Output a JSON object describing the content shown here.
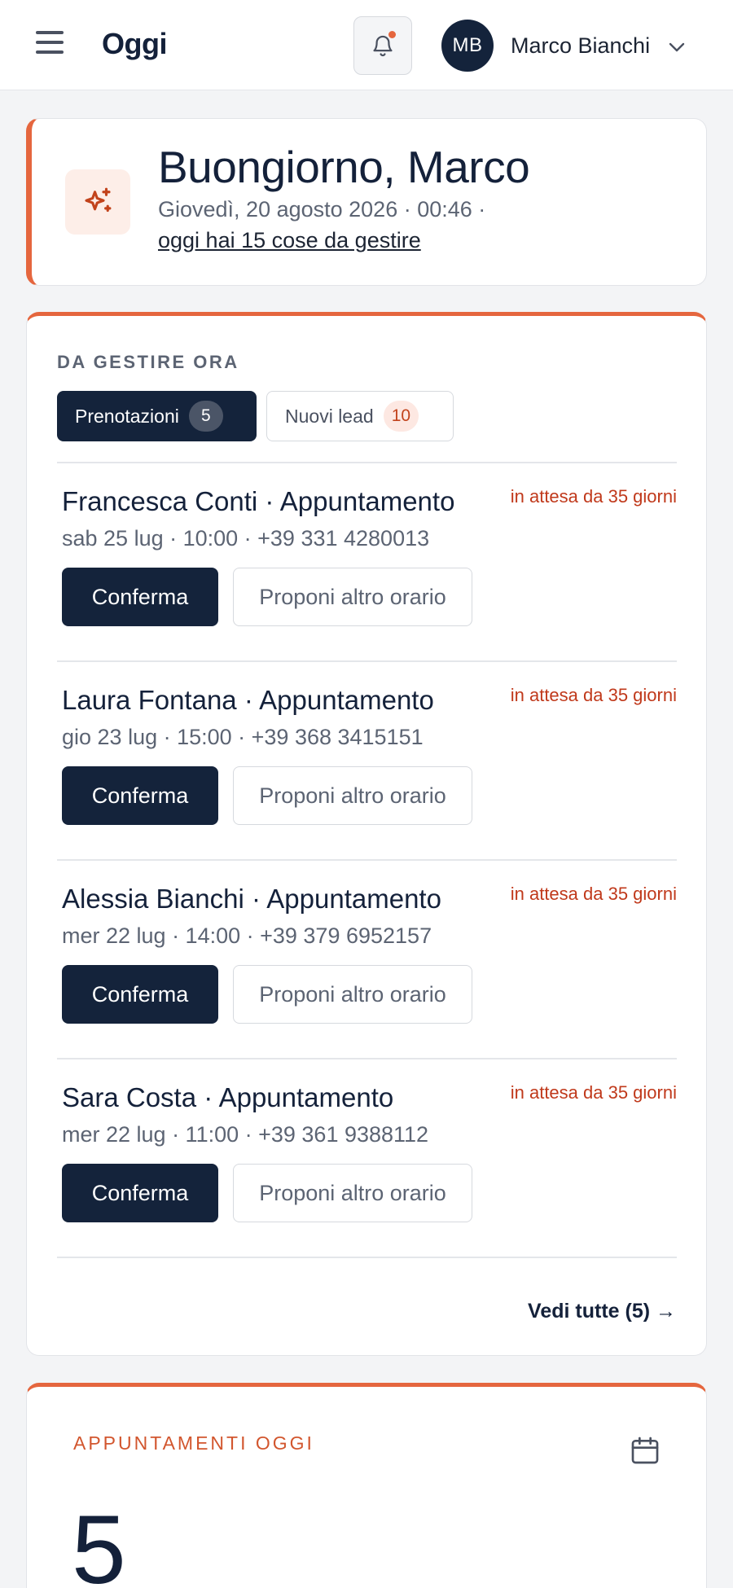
{
  "header": {
    "title": "Oggi",
    "user_initials": "MB",
    "user_name": "Marco Bianchi",
    "notification_dot_color": "#e5663e"
  },
  "greeting": {
    "title": "Buongiorno, Marco",
    "date_line": "Giovedì, 20 agosto 2026 · 00:46 ·",
    "tasks_link": "oggi hai 15 cose da gestire"
  },
  "todo": {
    "section_label": "DA GESTIRE ORA",
    "tabs": [
      {
        "label": "Prenotazioni",
        "count": "5",
        "active": true
      },
      {
        "label": "Nuovi lead",
        "count": "10",
        "active": false
      }
    ],
    "bookings": [
      {
        "title": "Francesca Conti · Appuntamento",
        "meta": "sab 25 lug · 10:00 · +39 331 4280013",
        "waiting": "in attesa da 35 giorni",
        "confirm_label": "Conferma",
        "propose_label": "Proponi altro orario"
      },
      {
        "title": "Laura Fontana · Appuntamento",
        "meta": "gio 23 lug · 15:00 · +39 368 3415151",
        "waiting": "in attesa da 35 giorni",
        "confirm_label": "Conferma",
        "propose_label": "Proponi altro orario"
      },
      {
        "title": "Alessia Bianchi · Appuntamento",
        "meta": "mer 22 lug · 14:00 · +39 379 6952157",
        "waiting": "in attesa da 35 giorni",
        "confirm_label": "Conferma",
        "propose_label": "Proponi altro orario"
      },
      {
        "title": "Sara Costa · Appuntamento",
        "meta": "mer 22 lug · 11:00 · +39 361 9388112",
        "waiting": "in attesa da 35 giorni",
        "confirm_label": "Conferma",
        "propose_label": "Proponi altro orario"
      }
    ],
    "see_all_label": "Vedi tutte (5) →"
  },
  "appointments_today": {
    "label": "APPUNTAMENTI OGGI",
    "count": "5"
  },
  "colors": {
    "accent": "#e5663e",
    "navy": "#14233b",
    "warning_text": "#c0391b"
  },
  "icons": {
    "menu": "menu-icon",
    "bell": "bell-icon",
    "chevron": "chevron-down-icon",
    "sparkle": "sparkle-icon",
    "calendar": "calendar-icon"
  }
}
